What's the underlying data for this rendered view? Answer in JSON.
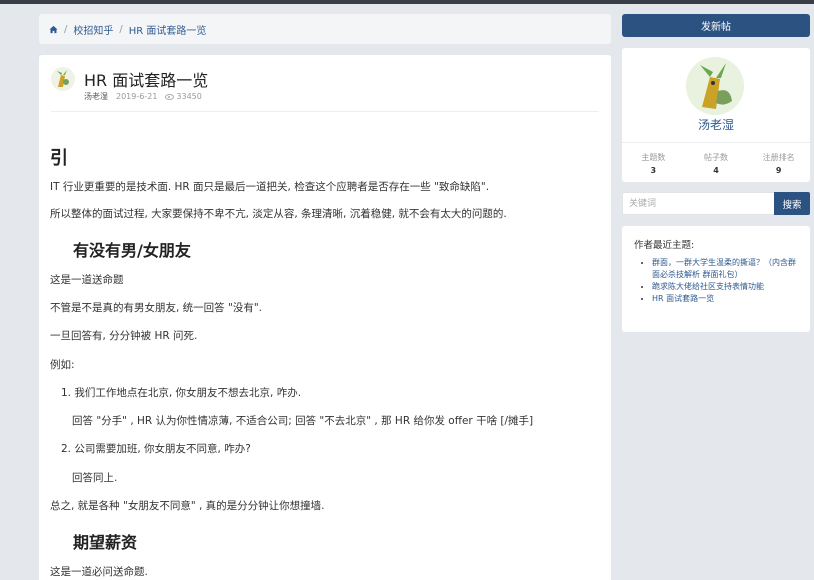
{
  "breadcrumb": {
    "items": [
      "校招知乎",
      "HR 面试套路一览"
    ],
    "separator": "/"
  },
  "post": {
    "title": "HR 面试套路一览",
    "author": "汤老湿",
    "date": "2019-6-21",
    "views": "33450"
  },
  "content": {
    "h_intro": "引",
    "p1": "IT 行业更重要的是技术面. HR 面只是最后一道把关, 检查这个应聘者是否存在一些 \"致命缺陷\".",
    "p2": "所以整体的面试过程, 大家要保持不卑不亢, 淡定从容, 条理清晰, 沉着稳健, 就不会有太大的问题的.",
    "h_bf": "有没有男/女朋友",
    "p3": "这是一道送命题",
    "p4": "不管是不是真的有男女朋友, 统一回答 \"没有\".",
    "p5": "一旦回答有, 分分钟被 HR 问死.",
    "p6": "例如:",
    "li1": "1. 我们工作地点在北京, 你女朋友不想去北京, 咋办.",
    "li1_ans": "回答 \"分手\" , HR 认为你性情凉薄, 不适合公司; 回答 \"不去北京\" , 那 HR 给你发 offer 干啥 [/摊手]",
    "li2": "2. 公司需要加班, 你女朋友不同意, 咋办?",
    "li2_ans": "回答同上.",
    "p7": "总之, 就是各种 \"女朋友不同意\" , 真的是分分钟让你想撞墙.",
    "h_salary": "期望薪资",
    "p8": "这是一道必问送命题."
  },
  "sidebar": {
    "new_post_label": "发新帖",
    "profile_name": "汤老湿",
    "stats": [
      {
        "label": "主题数",
        "value": "3"
      },
      {
        "label": "帖子数",
        "value": "4"
      },
      {
        "label": "注册排名",
        "value": "9"
      }
    ],
    "search_placeholder": "关键词",
    "search_button": "搜索",
    "recent_title": "作者最近主题:",
    "recent_items": [
      "群面，一群大学生温柔的撕逼？（内含群面必杀技解析 群面礼包）",
      "跪求陈大佬给社区支持表情功能",
      "HR 面试套路一览"
    ]
  },
  "colors": {
    "primary": "#2c5282",
    "link": "#2e5a8f",
    "background": "#e4e7ec"
  },
  "icons": [
    "home-icon",
    "eye-icon",
    "avatar"
  ]
}
